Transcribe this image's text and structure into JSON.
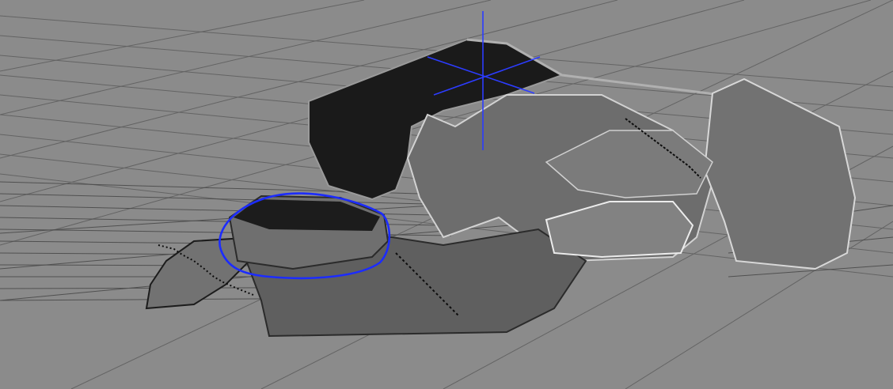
{
  "viewport": {
    "background_color": "#8b8b8b",
    "grid_color": "#5a5a5a",
    "model_color": "#6f6f6f",
    "highlight_color": "#1c2cff",
    "axis_color": "#2c3cff"
  },
  "annotations": {
    "highlight_shape": "ellipse"
  },
  "icons": {
    "origin_axis": "axis-gizmo-icon"
  }
}
